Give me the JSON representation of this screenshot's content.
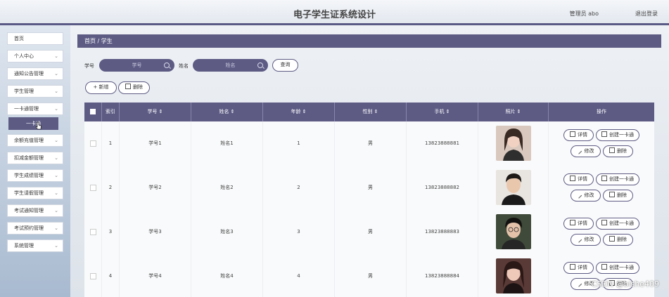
{
  "header": {
    "title": "电子学生证系统设计",
    "admin": "管理员 abo",
    "logout": "退出登录"
  },
  "sidebar": {
    "items": [
      {
        "label": "首页",
        "chevron": ""
      },
      {
        "label": "个人中心",
        "chevron": "⌄"
      },
      {
        "label": "通知公告管理",
        "chevron": "⌄"
      },
      {
        "label": "学生管理",
        "chevron": "⌄"
      },
      {
        "label": "一卡通管理",
        "chevron": "⌄"
      },
      {
        "label": "余额充值管理",
        "chevron": "⌄"
      },
      {
        "label": "扣减金额管理",
        "chevron": "⌄"
      },
      {
        "label": "学生成绩管理",
        "chevron": "⌄"
      },
      {
        "label": "学生请假管理",
        "chevron": "⌄"
      },
      {
        "label": "考试通知管理",
        "chevron": "⌄"
      },
      {
        "label": "考试预约管理",
        "chevron": "⌄"
      },
      {
        "label": "系统管理",
        "chevron": "⌄"
      }
    ],
    "subitem": "一卡通"
  },
  "breadcrumb": "首页 / 学生",
  "search": {
    "id_label": "学号",
    "id_placeholder": "学号",
    "name_label": "姓名",
    "name_placeholder": "姓名",
    "query": "查询"
  },
  "actions": {
    "add": "+ 新增",
    "delete": "删除"
  },
  "table": {
    "headers": [
      "索引",
      "学号 ⇕",
      "姓名 ⇕",
      "年龄 ⇕",
      "性别 ⇕",
      "手机 ⇕",
      "照片 ⇕",
      "操作"
    ],
    "rows": [
      {
        "index": "1",
        "id": "学号1",
        "name": "姓名1",
        "age": "1",
        "gender": "男",
        "phone": "13823888881"
      },
      {
        "index": "2",
        "id": "学号2",
        "name": "姓名2",
        "age": "2",
        "gender": "男",
        "phone": "13823888882"
      },
      {
        "index": "3",
        "id": "学号3",
        "name": "姓名3",
        "age": "3",
        "gender": "男",
        "phone": "13823888883"
      },
      {
        "index": "4",
        "id": "学号4",
        "name": "姓名4",
        "age": "4",
        "gender": "男",
        "phone": "13823888884"
      }
    ],
    "buttons": {
      "detail": "详情",
      "create_card": "创建一卡通",
      "edit": "修改",
      "delete": "删除"
    }
  },
  "watermark": "CSDN @bishe409",
  "colors": {
    "accent": "#5d5b84"
  }
}
